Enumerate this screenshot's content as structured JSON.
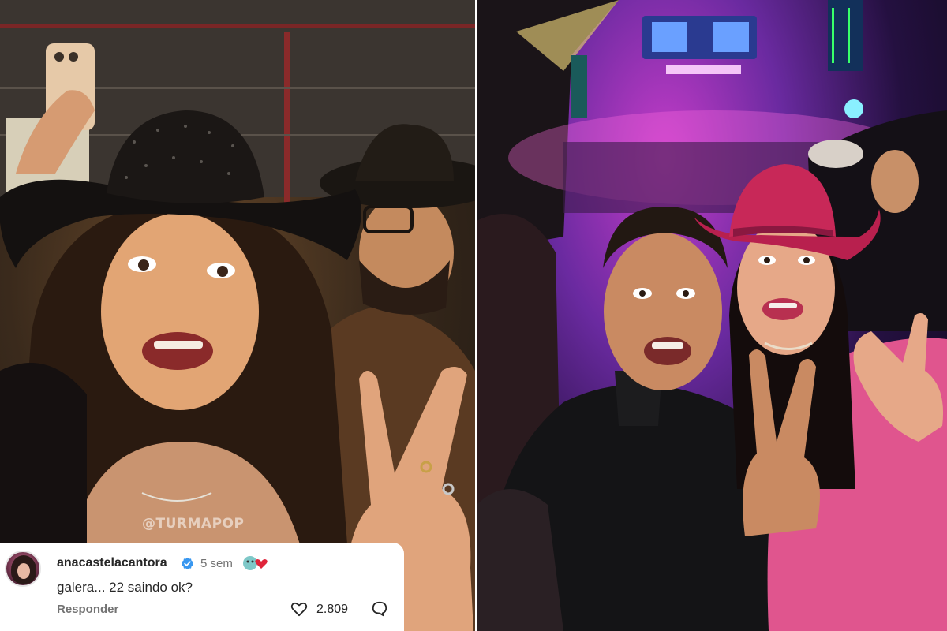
{
  "watermark": "@TURMAPOP",
  "comment": {
    "username": "anacastelacantora",
    "time": "5 sem",
    "text": "galera... 22 saindo ok?",
    "reply_label": "Responder",
    "likes": "2.809"
  },
  "icons": {
    "verified": "verified-badge-icon",
    "heart": "heart-icon",
    "reply": "reply-icon"
  },
  "colors": {
    "verified": "#3897f0",
    "card": "#ffffff",
    "stage_glow": "#c43cc8"
  }
}
